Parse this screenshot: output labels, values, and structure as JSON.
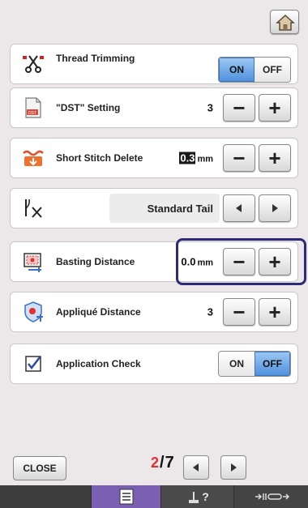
{
  "header": {
    "home_icon": "home-icon"
  },
  "settings": [
    {
      "id": "thread-trimming",
      "label": "Thread Trimming",
      "icon": "scissors-icon",
      "control": "toggle",
      "on_label": "ON",
      "off_label": "OFF",
      "state": "ON"
    },
    {
      "id": "dst-setting",
      "label": "\"DST\" Setting",
      "icon": "dst-file-icon",
      "control": "stepper",
      "value": "3",
      "unit": ""
    },
    {
      "id": "short-stitch-delete",
      "label": "Short Stitch Delete",
      "icon": "short-stitch-icon",
      "control": "stepper",
      "value": "0.3",
      "unit": "mm"
    },
    {
      "id": "tail",
      "label": "",
      "icon": "thread-tail-icon",
      "control": "selector",
      "value": "Standard Tail"
    },
    {
      "id": "basting-distance",
      "label": "Basting Distance",
      "icon": "basting-icon",
      "control": "stepper",
      "value": "0.0",
      "unit": "mm",
      "focused": true
    },
    {
      "id": "applique-distance",
      "label": "Appliqué Distance",
      "icon": "applique-icon",
      "control": "stepper",
      "value": "3",
      "unit": ""
    },
    {
      "id": "application-check",
      "label": "Application Check",
      "icon": "checkbox-icon",
      "control": "toggle",
      "on_label": "ON",
      "off_label": "OFF",
      "state": "OFF"
    }
  ],
  "footer": {
    "close_label": "CLOSE",
    "page_current": "2",
    "page_total": "7"
  },
  "taskbar": {
    "items": [
      {
        "icon": "settings-list-icon",
        "active": true
      },
      {
        "icon": "help-icon",
        "glyph": "?"
      },
      {
        "icon": "needle-icon"
      }
    ]
  },
  "colors": {
    "toggle_active": "#4d8fdc",
    "focus_ring": "#2d2a7a",
    "page_current": "#e03030",
    "taskbar_active": "#7b5fb2"
  }
}
